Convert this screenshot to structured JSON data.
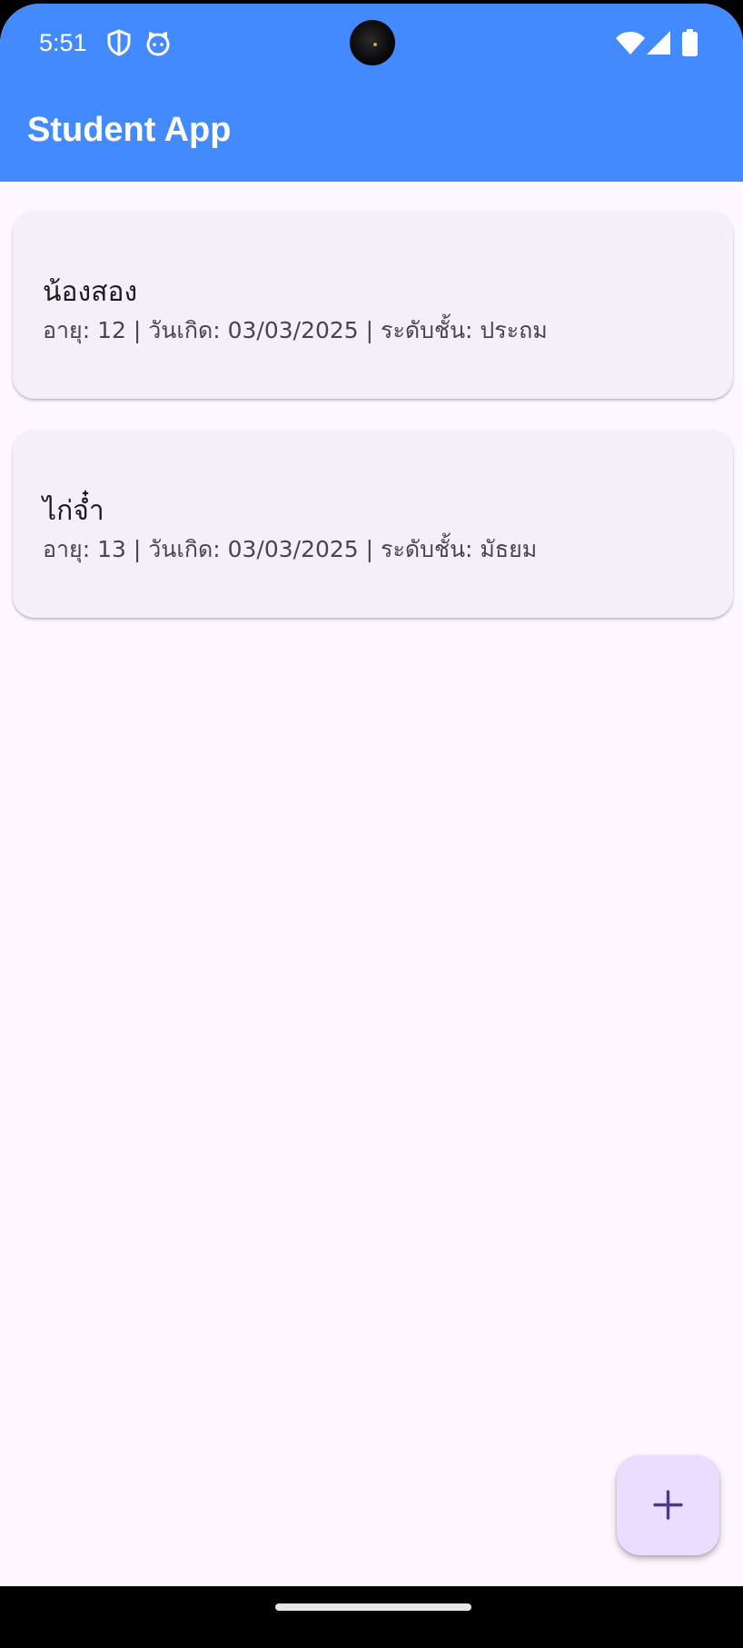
{
  "status_bar": {
    "time": "5:51",
    "left_icons": [
      "shield-icon",
      "cat-face-icon"
    ],
    "right_icons": [
      "wifi-icon",
      "cellular-signal-icon",
      "battery-icon"
    ]
  },
  "app_bar": {
    "title": "Student App",
    "color": "#448AFF"
  },
  "students": [
    {
      "name": "น้องสอง",
      "detail": "อายุ: 12 | วันเกิด: 03/03/2025 | ระดับชั้น: ประถม"
    },
    {
      "name": "ไก่จ๋ำ",
      "detail": "อายุ: 13 | วันเกิด: 03/03/2025 | ระดับชั้น: มัธยม"
    }
  ],
  "fab": {
    "icon": "plus-icon",
    "color": "#EADDFF",
    "icon_color": "#4F378B"
  },
  "colors": {
    "background": "#FDF7FF",
    "card": "#F4F1F6"
  }
}
